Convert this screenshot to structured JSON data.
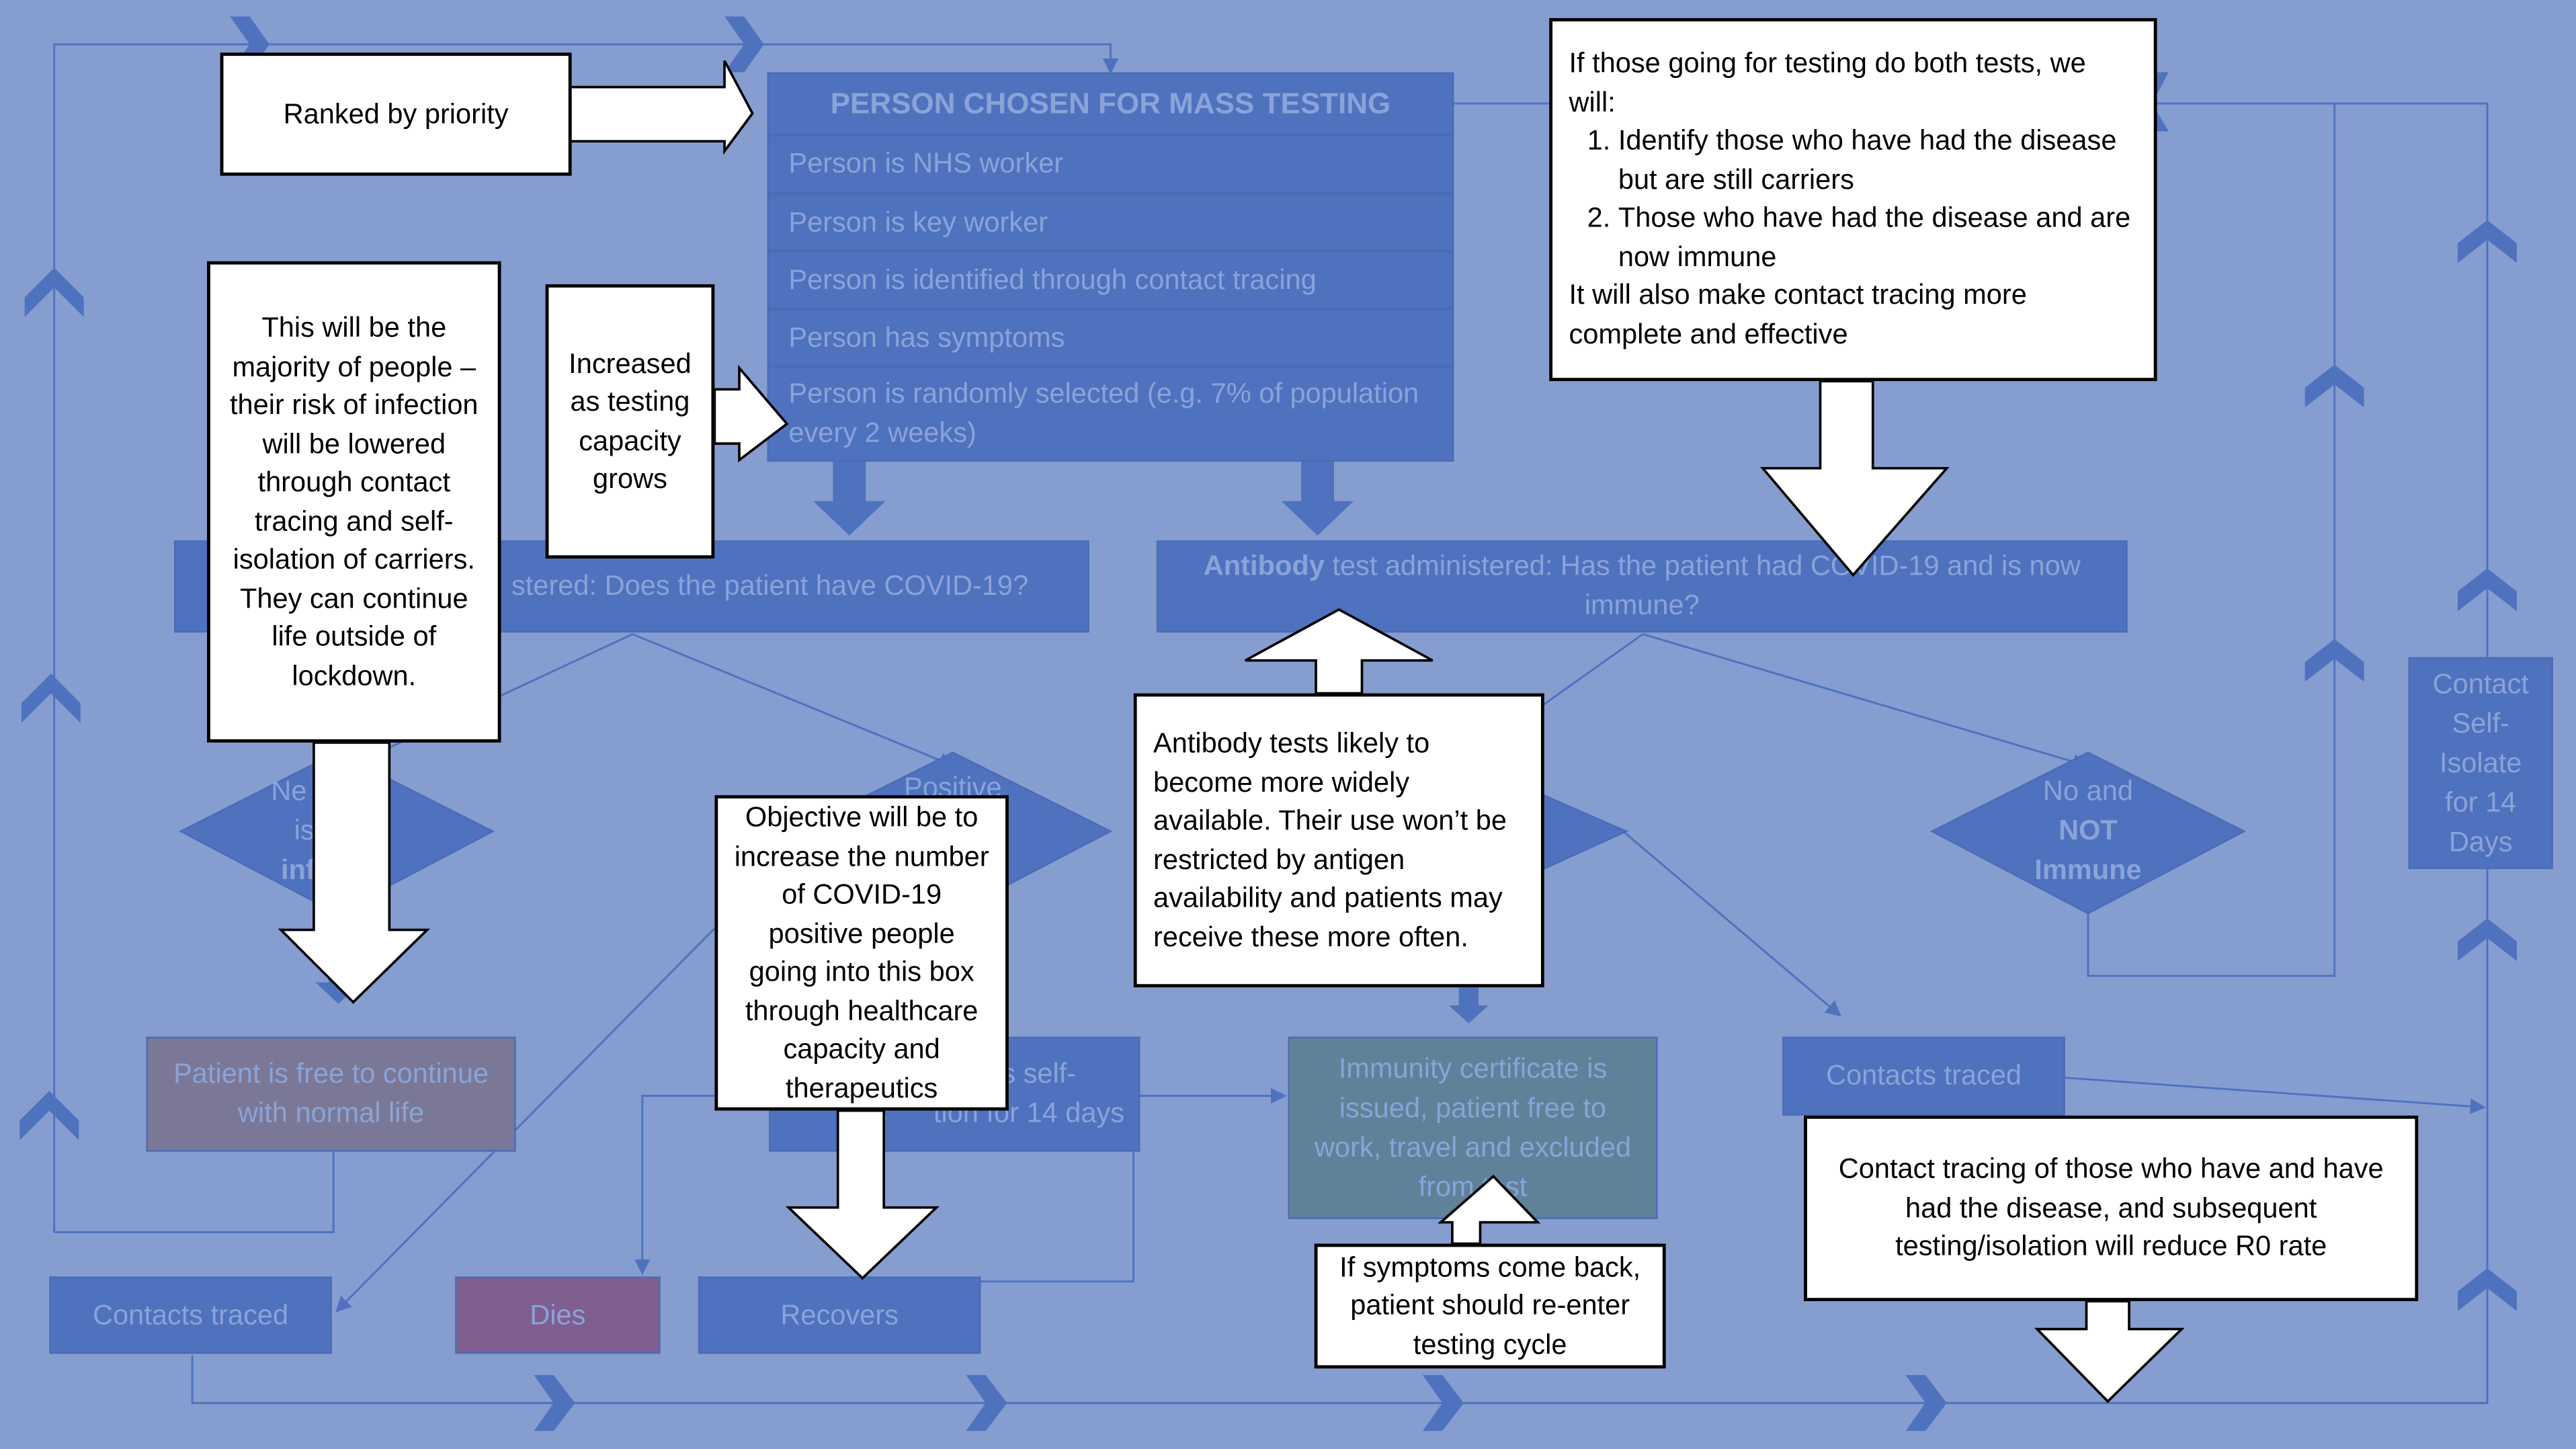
{
  "colors": {
    "background": "#869dd0",
    "box_fill": "#4f72bf",
    "box_text": "#8aa3d8",
    "connector": "#4f72bf",
    "free_box": "#7b7897",
    "dies_box": "#7f5e90",
    "immunity_box": "#5f8299",
    "callout_fill": "#ffffff",
    "callout_border": "#000000"
  },
  "flow": {
    "selection_table": {
      "header": "PERSON CHOSEN FOR  MASS TESTING",
      "rows": [
        "Person is NHS worker",
        "Person is key worker",
        "Person is identified through contact tracing",
        "Person has symptoms",
        "Person is randomly selected (e.g. 7% of population every 2 weeks)"
      ]
    },
    "antigen_test": "stered: Does the patient have COVID-19?",
    "antibody_test": {
      "bold": "Antibody",
      "rest": " test administered: Has the patient had COVID-19 and is now immune?"
    },
    "diamond_negative": {
      "line1": "Ne",
      "line2": "is",
      "line3": "inf"
    },
    "diamond_positive": {
      "line1": "Positive"
    },
    "diamond_not_immune": {
      "line1": "No  and",
      "line2": "NOT",
      "line3": "Immune"
    },
    "patient_free": "Patient is free to continue with normal life",
    "self_isolation_line1": "s self-",
    "self_isolation_line2": "is      tion for 14 days",
    "immunity_certificate": "Immunity certificate is issued, patient free to work, travel and excluded from test",
    "contacts_traced_right": "Contacts traced",
    "contacts_traced_left": "Contacts traced",
    "dies": "Dies",
    "recovers": "Recovers",
    "contact_self_isolate": "Contact Self-Isolate for 14 Days"
  },
  "callouts": {
    "ranked": "Ranked by priority",
    "increased": "Increased as testing capacity grows",
    "majority": "This will be the majority of people – their risk of infection will be lowered through contact tracing and self-isolation of carriers. They can continue life outside of lockdown.",
    "both_tests": {
      "intro": "If those going for testing do both tests, we will:",
      "items": [
        "Identify those who have had the disease but are still carriers",
        "Those who have had the disease and are now immune"
      ],
      "outro": "It will also make contact tracing more complete and effective"
    },
    "antibody_avail": "Antibody tests likely to become more widely available. Their use won’t be restricted by antigen availability and patients may receive these more often.",
    "objective": "Objective will be to increase the number of COVID-19 positive people going into this box through healthcare capacity and therapeutics",
    "symptoms_back": "If symptoms come back, patient should re-enter testing cycle",
    "contact_tracing_r0": "Contact tracing of those who have and have had the disease, and subsequent testing/isolation will reduce R0 rate"
  }
}
